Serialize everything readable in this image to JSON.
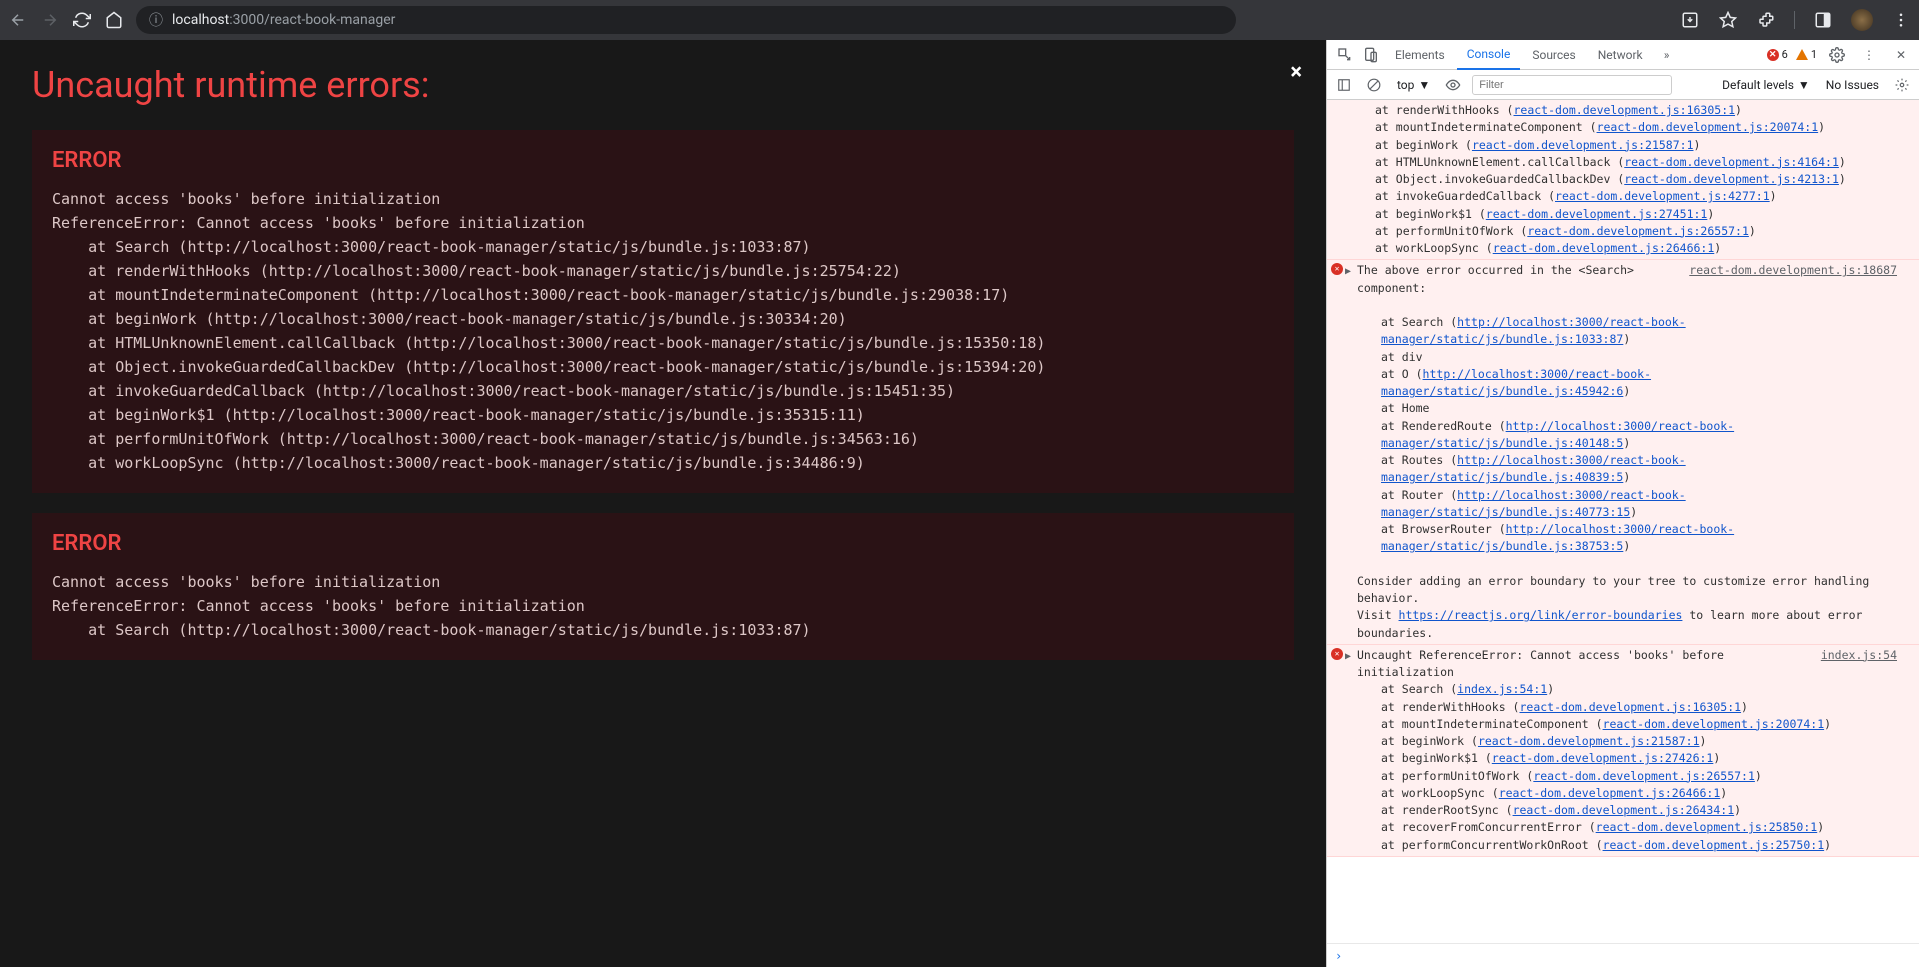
{
  "browser": {
    "url_host": "localhost",
    "url_port_path": ":3000/react-book-manager"
  },
  "overlay": {
    "title": "Uncaught runtime errors:",
    "close": "×",
    "blocks": [
      {
        "heading": "ERROR",
        "message": "Cannot access 'books' before initialization",
        "trace": "ReferenceError: Cannot access 'books' before initialization\n    at Search (http://localhost:3000/react-book-manager/static/js/bundle.js:1033:87)\n    at renderWithHooks (http://localhost:3000/react-book-manager/static/js/bundle.js:25754:22)\n    at mountIndeterminateComponent (http://localhost:3000/react-book-manager/static/js/bundle.js:29038:17)\n    at beginWork (http://localhost:3000/react-book-manager/static/js/bundle.js:30334:20)\n    at HTMLUnknownElement.callCallback (http://localhost:3000/react-book-manager/static/js/bundle.js:15350:18)\n    at Object.invokeGuardedCallbackDev (http://localhost:3000/react-book-manager/static/js/bundle.js:15394:20)\n    at invokeGuardedCallback (http://localhost:3000/react-book-manager/static/js/bundle.js:15451:35)\n    at beginWork$1 (http://localhost:3000/react-book-manager/static/js/bundle.js:35315:11)\n    at performUnitOfWork (http://localhost:3000/react-book-manager/static/js/bundle.js:34563:16)\n    at workLoopSync (http://localhost:3000/react-book-manager/static/js/bundle.js:34486:9)"
      },
      {
        "heading": "ERROR",
        "message": "Cannot access 'books' before initialization",
        "trace": "ReferenceError: Cannot access 'books' before initialization\n    at Search (http://localhost:3000/react-book-manager/static/js/bundle.js:1033:87)"
      }
    ]
  },
  "devtools": {
    "tabs": {
      "elements": "Elements",
      "console": "Console",
      "sources": "Sources",
      "network": "Network"
    },
    "badges": {
      "errors": "6",
      "warnings": "1"
    },
    "toolbar": {
      "context": "top",
      "filter_placeholder": "Filter",
      "levels": "Default levels",
      "issues": "No Issues"
    },
    "log0": {
      "l1": "    at renderWithHooks (",
      "a1": "react-dom.development.js:16305:1",
      "p1": ")",
      "l2": "    at mountIndeterminateComponent (",
      "a2": "react-dom.development.js:20074:1",
      "p2": ")",
      "l3": "    at beginWork (",
      "a3": "react-dom.development.js:21587:1",
      "p3": ")",
      "l4": "    at HTMLUnknownElement.callCallback (",
      "a4": "react-dom.development.js:4164:1",
      "p4": ")",
      "l5": "    at Object.invokeGuardedCallbackDev (",
      "a5": "react-dom.development.js:4213:1",
      "p5": ")",
      "l6": "    at invokeGuardedCallback (",
      "a6": "react-dom.development.js:4277:1",
      "p6": ")",
      "l7": "    at beginWork$1 (",
      "a7": "react-dom.development.js:27451:1",
      "p7": ")",
      "l8": "    at performUnitOfWork (",
      "a8": "react-dom.development.js:26557:1",
      "p8": ")",
      "l9": "    at workLoopSync (",
      "a9": "react-dom.development.js:26466:1",
      "p9": ")"
    },
    "log1": {
      "src": "react-dom.development.js:18687",
      "msg1": "The above error occurred in the <Search> component:",
      "t1": "    at Search (",
      "ta1": "http://localhost:3000/react-book-manager/static/js/bundle.js:1033:87",
      "tp1": ")",
      "t2": "    at div",
      "t3": "    at O (",
      "ta3": "http://localhost:3000/react-book-manager/static/js/bundle.js:45942:6",
      "tp3": ")",
      "t4": "    at Home",
      "t5": "    at RenderedRoute (",
      "ta5": "http://localhost:3000/react-book-manager/static/js/bundle.js:40148:5",
      "tp5": ")",
      "t6": "    at Routes (",
      "ta6": "http://localhost:3000/react-book-manager/static/js/bundle.js:40839:5",
      "tp6": ")",
      "t7": "    at Router (",
      "ta7": "http://localhost:3000/react-book-manager/static/js/bundle.js:40773:15",
      "tp7": ")",
      "t8": "    at BrowserRouter (",
      "ta8": "http://localhost:3000/react-book-manager/static/js/bundle.js:38753:5",
      "tp8": ")",
      "msg2": "Consider adding an error boundary to your tree to customize error handling behavior.",
      "msg3a": "Visit ",
      "msg3link": "https://reactjs.org/link/error-boundaries",
      "msg3b": " to learn more about error boundaries."
    },
    "log2": {
      "src": "index.js:54",
      "msg": "Uncaught ReferenceError: Cannot access 'books' before initialization",
      "t1": "    at Search (",
      "ta1": "index.js:54:1",
      "tp1": ")",
      "t2": "    at renderWithHooks (",
      "ta2": "react-dom.development.js:16305:1",
      "tp2": ")",
      "t3": "    at mountIndeterminateComponent (",
      "ta3": "react-dom.development.js:20074:1",
      "tp3": ")",
      "t4": "    at beginWork (",
      "ta4": "react-dom.development.js:21587:1",
      "tp4": ")",
      "t5": "    at beginWork$1 (",
      "ta5": "react-dom.development.js:27426:1",
      "tp5": ")",
      "t6": "    at performUnitOfWork (",
      "ta6": "react-dom.development.js:26557:1",
      "tp6": ")",
      "t7": "    at workLoopSync (",
      "ta7": "react-dom.development.js:26466:1",
      "tp7": ")",
      "t8": "    at renderRootSync (",
      "ta8": "react-dom.development.js:26434:1",
      "tp8": ")",
      "t9": "    at recoverFromConcurrentError (",
      "ta9": "react-dom.development.js:25850:1",
      "tp9": ")",
      "t10": "    at performConcurrentWorkOnRoot (",
      "ta10": "react-dom.development.js:25750:1",
      "tp10": ")"
    },
    "prompt": "›"
  }
}
